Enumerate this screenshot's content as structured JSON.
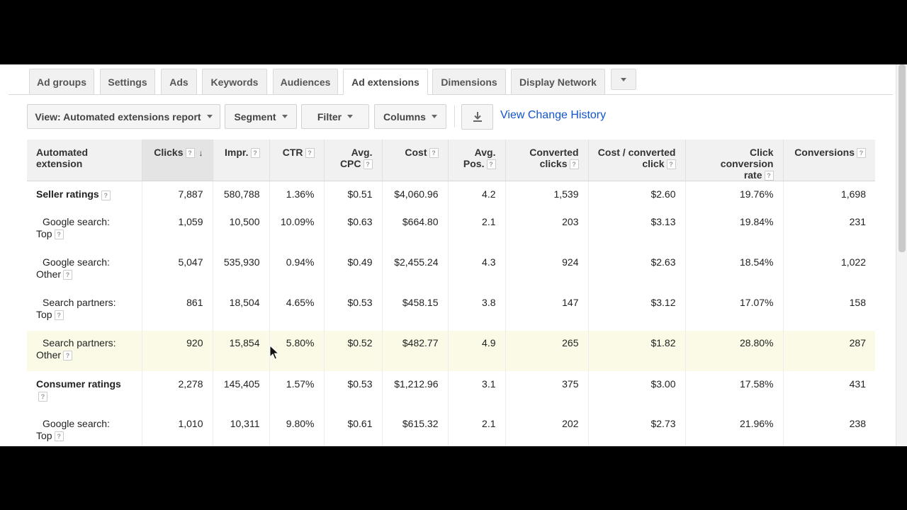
{
  "tabs": [
    {
      "label": "Ad groups",
      "active": false
    },
    {
      "label": "Settings",
      "active": false
    },
    {
      "label": "Ads",
      "active": false
    },
    {
      "label": "Keywords",
      "active": false
    },
    {
      "label": "Audiences",
      "active": false
    },
    {
      "label": "Ad extensions",
      "active": true
    },
    {
      "label": "Dimensions",
      "active": false
    },
    {
      "label": "Display Network",
      "active": false
    }
  ],
  "toolbar": {
    "view_label": "View: Automated extensions report",
    "segment_label": "Segment",
    "filter_label": "Filter",
    "columns_label": "Columns",
    "history_link": "View Change History",
    "download_icon": "download-icon"
  },
  "table": {
    "help_glyph": "?",
    "sort_glyph": "↓",
    "headers": {
      "extension_line1": "Automated",
      "extension_line2": "extension",
      "clicks": "Clicks",
      "impr": "Impr.",
      "ctr": "CTR",
      "avg_cpc_line1": "Avg.",
      "avg_cpc_line2": "CPC",
      "cost": "Cost",
      "avg_pos_line1": "Avg.",
      "avg_pos_line2": "Pos.",
      "conv_clicks_line1": "Converted",
      "conv_clicks_line2": "clicks",
      "cost_per_line1": "Cost / converted",
      "cost_per_line2": "click",
      "rate_line1": "Click conversion",
      "rate_line2": "rate",
      "conversions": "Conversions"
    },
    "rows": [
      {
        "name": "Seller ratings",
        "clicks": "7,887",
        "impr": "580,788",
        "ctr": "1.36%",
        "cpc": "$0.51",
        "cost": "$4,060.96",
        "pos": "4.2",
        "conv": "1,539",
        "cpconv": "$2.60",
        "rate": "19.76%",
        "conversions": "1,698"
      },
      {
        "name_line1": "Google search:",
        "name_line2": "Top",
        "clicks": "1,059",
        "impr": "10,500",
        "ctr": "10.09%",
        "cpc": "$0.63",
        "cost": "$664.80",
        "pos": "2.1",
        "conv": "203",
        "cpconv": "$3.13",
        "rate": "19.84%",
        "conversions": "231"
      },
      {
        "name_line1": "Google search:",
        "name_line2": "Other",
        "clicks": "5,047",
        "impr": "535,930",
        "ctr": "0.94%",
        "cpc": "$0.49",
        "cost": "$2,455.24",
        "pos": "4.3",
        "conv": "924",
        "cpconv": "$2.63",
        "rate": "18.54%",
        "conversions": "1,022"
      },
      {
        "name_line1": "Search partners:",
        "name_line2": "Top",
        "clicks": "861",
        "impr": "18,504",
        "ctr": "4.65%",
        "cpc": "$0.53",
        "cost": "$458.15",
        "pos": "3.8",
        "conv": "147",
        "cpconv": "$3.12",
        "rate": "17.07%",
        "conversions": "158"
      },
      {
        "name_line1": "Search partners:",
        "name_line2": "Other",
        "clicks": "920",
        "impr": "15,854",
        "ctr": "5.80%",
        "cpc": "$0.52",
        "cost": "$482.77",
        "pos": "4.9",
        "conv": "265",
        "cpconv": "$1.82",
        "rate": "28.80%",
        "conversions": "287"
      },
      {
        "name": "Consumer ratings",
        "clicks": "2,278",
        "impr": "145,405",
        "ctr": "1.57%",
        "cpc": "$0.53",
        "cost": "$1,212.96",
        "pos": "3.1",
        "conv": "375",
        "cpconv": "$3.00",
        "rate": "17.58%",
        "conversions": "431"
      },
      {
        "name_line1": "Google search:",
        "name_line2": "Top",
        "clicks": "1,010",
        "impr": "10,311",
        "ctr": "9.80%",
        "cpc": "$0.61",
        "cost": "$615.32",
        "pos": "2.1",
        "conv": "202",
        "cpconv": "$2.73",
        "rate": "21.96%",
        "conversions": "238"
      }
    ]
  },
  "colors": {
    "link": "#1155cc",
    "highlight_row": "#fafae6",
    "header_bg": "#f1f1f1"
  }
}
